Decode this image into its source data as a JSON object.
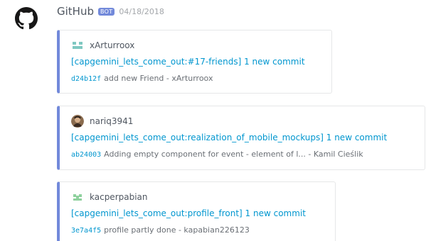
{
  "message": {
    "author": "GitHub",
    "bot_tag": "BOT",
    "timestamp": "04/18/2018",
    "avatar_icon": "github-octocat-icon"
  },
  "embeds": [
    {
      "author": "xArturroox",
      "author_icon": "default-avatar-icon",
      "title": "[capgemini_lets_come_out:#17-friends] 1 new commit",
      "commit_hash": "d24b12f",
      "commit_message": "add new Friend - xArturroox"
    },
    {
      "author": "nariq3941",
      "author_icon": "user-photo-avatar",
      "title": "[capgemini_lets_come_out:realization_of_mobile_mockups] 1 new commit",
      "commit_hash": "ab24003",
      "commit_message": "Adding empty component for event - element of l... - Kamil Cieślik"
    },
    {
      "author": "kacperpabian",
      "author_icon": "identicon-avatar",
      "title": "[capgemini_lets_come_out:profile_front] 1 new commit",
      "commit_hash": "3e7a4f5",
      "commit_message": "profile partly done - kapabian226123"
    }
  ],
  "colors": {
    "embed_accent": "#7289da",
    "link": "#0096cf",
    "bot_tag_bg": "#7289da"
  }
}
